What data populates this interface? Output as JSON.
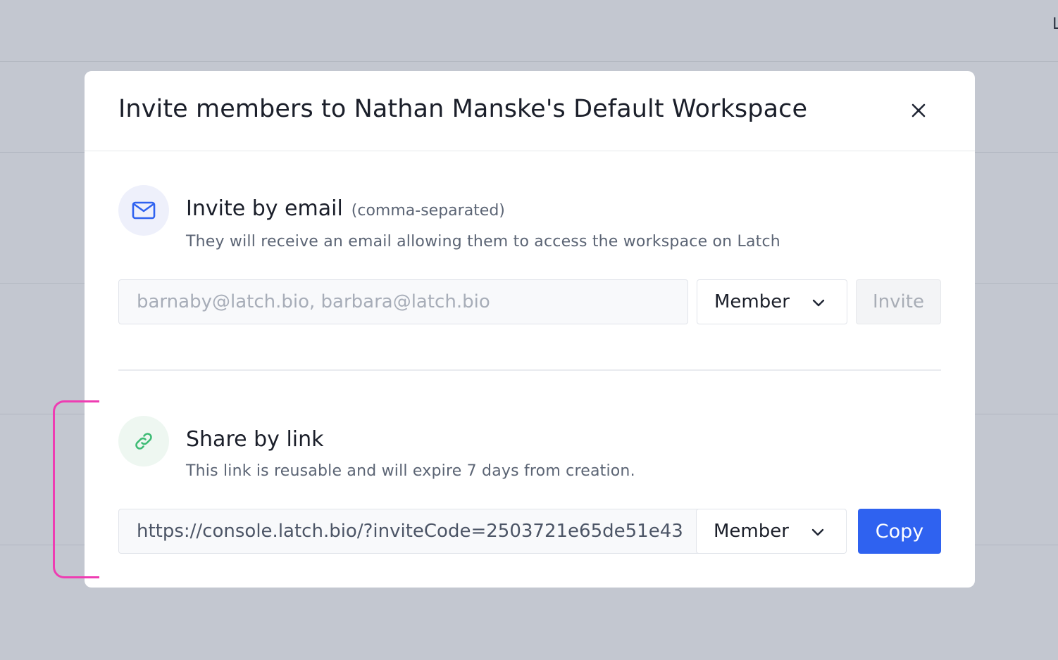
{
  "background": {
    "corner_text": "L"
  },
  "modal": {
    "title": "Invite members to Nathan Manske's Default Workspace",
    "close_icon": "close-icon"
  },
  "email_section": {
    "icon": "mail-icon",
    "title": "Invite by email",
    "note": "(comma-separated)",
    "description": "They will receive an email allowing them to access the workspace on Latch",
    "input_placeholder": "barnaby@latch.bio, barbara@latch.bio",
    "input_value": "",
    "role_selected": "Member",
    "invite_label": "Invite"
  },
  "link_section": {
    "icon": "link-icon",
    "title": "Share by link",
    "description": "This link is reusable and will expire 7 days from creation.",
    "link_value": "https://console.latch.bio/?inviteCode=2503721e65de51e43",
    "role_selected": "Member",
    "copy_label": "Copy"
  },
  "colors": {
    "accent": "#2f62f0",
    "annotation": "#ee3db2",
    "link_icon": "#3dbb74",
    "mail_icon": "#2f62f0"
  }
}
